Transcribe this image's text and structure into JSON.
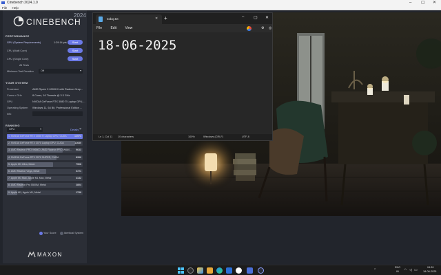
{
  "window": {
    "title": "Cinebench 2024.1.0",
    "menu": [
      "File",
      "Help"
    ]
  },
  "brand": {
    "name": "CINEBENCH",
    "year": "2024",
    "maxon": "MAXON"
  },
  "performance": {
    "title": "PERFORMANCE",
    "gpu_label": "GPU (System Requirements)",
    "gpu_time": "1:29:14 pts",
    "cpu_multi": "CPU (Multi Core)",
    "cpu_single": "CPU (Single Core)",
    "all_tests": "All Tests",
    "min_duration_label": "Minimum Test Duration",
    "min_duration_value": "Off",
    "start_label": "Start"
  },
  "system": {
    "title": "YOUR SYSTEM",
    "rows": [
      {
        "label": "Processor",
        "value": "AMD Ryzen 9 6900HX with Radeon Grap..."
      },
      {
        "label": "Cores x GHz",
        "value": "8 Cores, 16 Threads @ 3.3 GHz"
      },
      {
        "label": "GPU",
        "value": "NVIDIA GeForce RTX 3080 Ti Laptop GPU,..."
      },
      {
        "label": "Operating System",
        "value": "Windows 11, 64 Bit, Professional Edition ..."
      },
      {
        "label": "Info",
        "value": ""
      }
    ]
  },
  "ranking": {
    "title": "RANKING",
    "filter": "GPU",
    "details_label": "Details",
    "rows": [
      {
        "name": "1. NVIDIA GeForce RTX 3080 Ti Laptop GPU, CUDA",
        "score": "12974",
        "bar": 1.0
      },
      {
        "name": "2. NVIDIA GeForce RTX 3070 Laptop GPU, CUDA",
        "score": "11680",
        "bar": 0.9
      },
      {
        "name": "3. AMD Radeon PRO W6800, AMD Radeon PRO W680...",
        "score": "9633",
        "bar": 0.74
      },
      {
        "name": "4. NVIDIA GeForce RTX 2070 SUPER, CUDA",
        "score": "8396",
        "bar": 0.65
      },
      {
        "name": "5. Apple M1 Ultra, Metal",
        "score": "7968",
        "bar": 0.61
      },
      {
        "name": "6. AMD Radeon Vega, Metal",
        "score": "6721",
        "bar": 0.52
      },
      {
        "name": "7. Apple M1 Max, Apple M1 Max, Metal",
        "score": "4132",
        "bar": 0.32
      },
      {
        "name": "8. AMD Radeon Pro 5500M, Metal",
        "score": "2804",
        "bar": 0.22
      },
      {
        "name": "9. Apple M1, Apple M1, Metal",
        "score": "1788",
        "bar": 0.14
      }
    ],
    "legend_your": "Your Score",
    "legend_identical": "Identical System"
  },
  "notepad": {
    "tab_title": "today.txt",
    "menu": [
      "File",
      "Edit",
      "View"
    ],
    "content": "18-06-2025",
    "status": {
      "position": "Ln 1, Col 11",
      "chars": "10 characters",
      "zoom": "100%",
      "eol": "Windows (CRLF)",
      "encoding": "UTF-8"
    }
  },
  "taskbar": {
    "lang_top": "ENG",
    "lang_bottom": "IN",
    "time": "04:39",
    "date": "18-06-2025"
  }
}
